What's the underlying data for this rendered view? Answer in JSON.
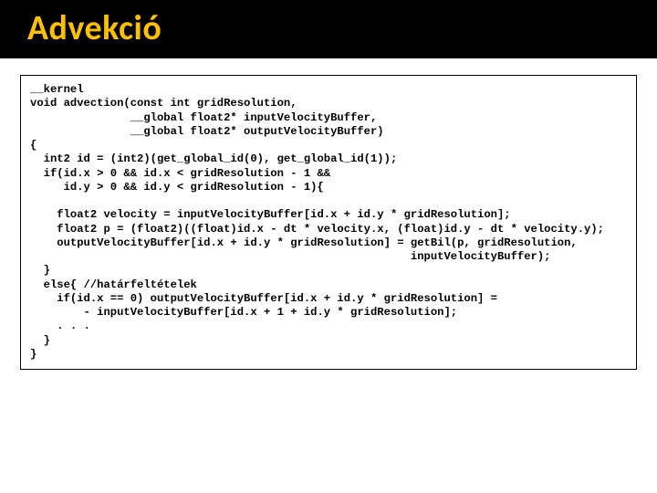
{
  "title": "Advekció",
  "code": "__kernel\nvoid advection(const int gridResolution,\n               __global float2* inputVelocityBuffer,\n               __global float2* outputVelocityBuffer)\n{\n  int2 id = (int2)(get_global_id(0), get_global_id(1));\n  if(id.x > 0 && id.x < gridResolution - 1 &&\n     id.y > 0 && id.y < gridResolution - 1){\n\n    float2 velocity = inputVelocityBuffer[id.x + id.y * gridResolution];\n    float2 p = (float2)((float)id.x - dt * velocity.x, (float)id.y - dt * velocity.y);\n    outputVelocityBuffer[id.x + id.y * gridResolution] = getBil(p, gridResolution,\n                                                         inputVelocityBuffer);\n  }\n  else{ //határfeltételek\n    if(id.x == 0) outputVelocityBuffer[id.x + id.y * gridResolution] =\n        - inputVelocityBuffer[id.x + 1 + id.y * gridResolution];\n    . . .\n  }\n}"
}
